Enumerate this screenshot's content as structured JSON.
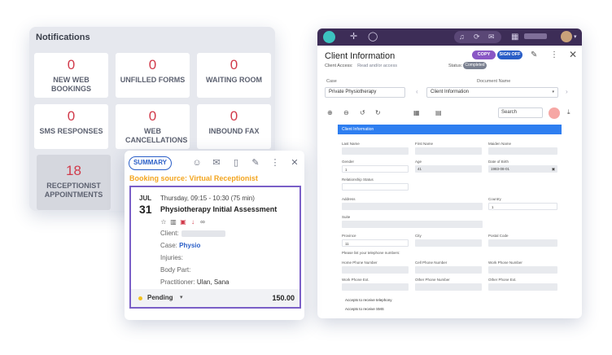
{
  "notifications": {
    "title": "Notifications",
    "tiles": [
      {
        "count": "0",
        "label": "NEW WEB BOOKINGS"
      },
      {
        "count": "0",
        "label": "UNFILLED FORMS"
      },
      {
        "count": "0",
        "label": "WAITING ROOM"
      },
      {
        "count": "0",
        "label": "SMS RESPONSES"
      },
      {
        "count": "0",
        "label": "WEB CANCELLATIONS"
      },
      {
        "count": "0",
        "label": "INBOUND FAX"
      },
      {
        "count": "18",
        "label": "RECEPTIONIST APPOINTMENTS"
      }
    ],
    "count_color": "#d13a4a"
  },
  "appointment": {
    "summary_label": "SUMMARY",
    "booking_source": "Booking source: Virtual Receptionist",
    "month": "JUL",
    "day": "31",
    "time": "Thursday, 09:15 - 10:30 (75 min)",
    "name": "Physiotherapy Initial Assessment",
    "client_label": "Client:",
    "case_label": "Case:",
    "case_value": "Physio",
    "injuries_label": "Injuries:",
    "body_part_label": "Body Part:",
    "practitioner_label": "Practitioner:",
    "practitioner_value": "Ulan, Sana",
    "status": "Pending",
    "price": "150.00",
    "accent": "#7a5fc7",
    "booking_color": "#f3a51f"
  },
  "client_info": {
    "title": "Client Information",
    "client_access_label": "Client Access:",
    "client_access_value": "Read and/or access",
    "copy_label": "COPY",
    "signoff_label": "SIGN OFF",
    "status_label": "Status:",
    "status_value": "Completed",
    "case_label": "Case",
    "case_value": "Private Physiotherapy",
    "document_label": "Document Name",
    "document_value": "Client Information",
    "search_placeholder": "Search",
    "form": {
      "header": "Client Information",
      "last_name": "Last Name",
      "first_name": "First Name",
      "maiden_name": "Maiden Name",
      "gender": "Gender",
      "gender_value": "1",
      "age": "Age",
      "age_value": "41",
      "dob": "Date of Birth",
      "dob_value": "1983-08-01",
      "relationship": "Relationship Status",
      "address": "Address",
      "country": "Country",
      "country_value": "1",
      "suite": "Suite",
      "province": "Province",
      "province_value": "11",
      "city": "City",
      "postal": "Postal Code",
      "phone_note": "Please list your telephone numbers:",
      "home_phone": "Home Phone Number",
      "cell_phone": "Cell Phone Number",
      "work_phone": "Work Phone Number",
      "work_ext": "Work Phone Ext.",
      "other_phone": "Other Phone Number",
      "other_ext": "Other Phone Ext.",
      "accept_tel": "Accepts to receive telephony",
      "accept_sms": "Accepts to receive SMS"
    },
    "topbar_color": "#3d2d57",
    "primary_color": "#2a5ec7"
  },
  "icons": [
    "user-icon",
    "mail-icon",
    "document-icon",
    "pencil-icon",
    "more-icon",
    "close-icon",
    "star-icon",
    "trash-icon",
    "calendar-icon",
    "arrow-down-icon",
    "link-icon",
    "plus-icon",
    "chat-icon",
    "bell-icon",
    "sync-icon",
    "megaphone-icon",
    "building-icon",
    "zoom-in-icon",
    "zoom-out-icon",
    "undo-icon",
    "redo-icon",
    "grid-icon",
    "page-icon",
    "print-icon",
    "download-icon"
  ]
}
